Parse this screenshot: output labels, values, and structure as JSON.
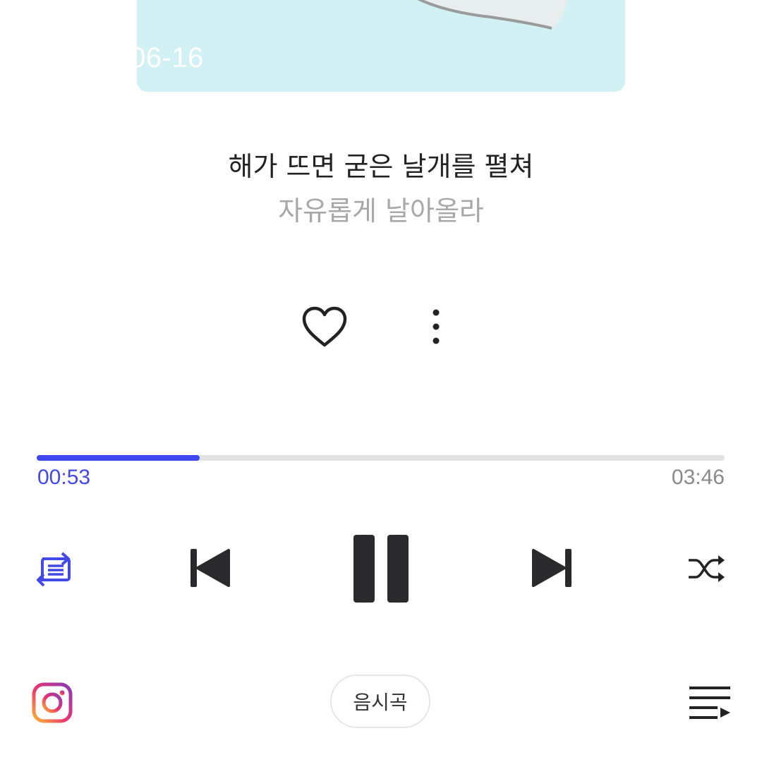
{
  "album": {
    "date_text": "06-16"
  },
  "lyrics": {
    "current": "해가 뜨면 굳은 날개를 펼쳐",
    "next": "자유롭게 날아올라"
  },
  "actions": {
    "like_icon": "heart-outline-icon",
    "more_icon": "vertical-dots-icon"
  },
  "playback": {
    "elapsed": "00:53",
    "total": "03:46",
    "progress_fraction": 0.237,
    "accent_color": "#3f47f0"
  },
  "controls": {
    "repeat_icon": "repeat-list-icon",
    "previous_icon": "skip-previous-icon",
    "pause_icon": "pause-icon",
    "next_icon": "skip-next-icon",
    "shuffle_icon": "shuffle-icon"
  },
  "bottom_bar": {
    "share_icon": "instagram-icon",
    "lyrics_label": "음시곡",
    "queue_icon": "playlist-queue-icon"
  }
}
